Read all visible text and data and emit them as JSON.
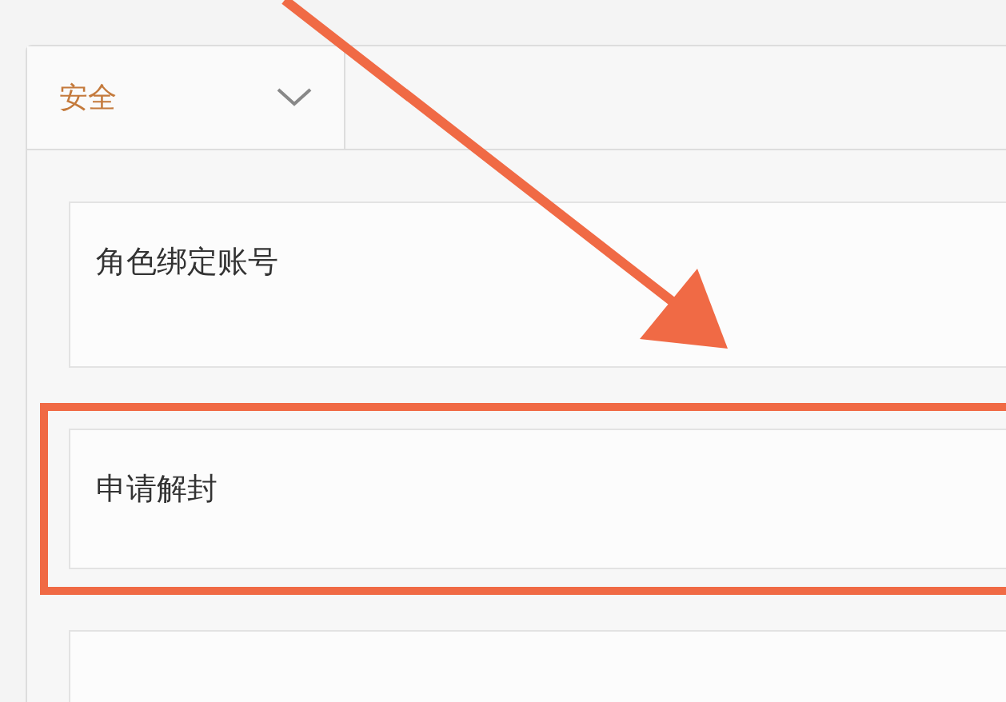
{
  "dropdown": {
    "label": "安全"
  },
  "items": [
    {
      "label": "角色绑定账号",
      "highlighted": false
    },
    {
      "label": "申请解封",
      "highlighted": true
    },
    {
      "highlighted": false
    }
  ]
}
